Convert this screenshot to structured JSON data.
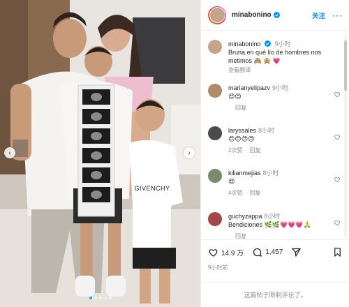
{
  "photo": {
    "alt": "Family photo with ultrasound strip",
    "shirt_text": "GIVENCHY",
    "carousel": {
      "count": 5,
      "active": 0
    },
    "prev_icon": "chevron-left-icon",
    "next_icon": "chevron-right-icon"
  },
  "header": {
    "username": "minabonino",
    "follow_label": "关注",
    "more_label": "···"
  },
  "caption": {
    "username": "minabonino",
    "time": "9小时",
    "text": "Bruna en qué lío de hombres nos metimos 🙈 🙊 💗",
    "translate": "查看翻译"
  },
  "comments": [
    {
      "username": "marianyelipazv",
      "time": "9小时",
      "text": "😍😍",
      "likes": "",
      "reply": "回复",
      "av_color": "#b08a6a"
    },
    {
      "username": "laryssales",
      "time": "8小时",
      "text": "😍😍😍😍",
      "likes": "2次赞",
      "reply": "回复",
      "av_color": "#4b4b4b"
    },
    {
      "username": "kilianmejias",
      "time": "8小时",
      "text": "😍",
      "likes": "4次赞",
      "reply": "回复",
      "av_color": "#7a8a6a"
    },
    {
      "username": "guchyzappa",
      "time": "8小时",
      "text": "Bendiciones 🌿🌿💗💗💗🙏",
      "likes": "",
      "reply": "回复",
      "av_color": "#a24848"
    }
  ],
  "actions": {
    "likes": "14.9 万",
    "comments": "1,457",
    "time_ago": "9小时前"
  },
  "footer": {
    "notice": "这篇帖子限制评论了。"
  },
  "colors": {
    "accent": "#0095f6",
    "muted": "#8e8e8e",
    "carousel_active": "#3897f0"
  }
}
